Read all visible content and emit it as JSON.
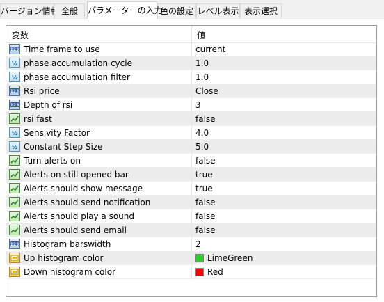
{
  "tabs": [
    {
      "label": "バージョン情報"
    },
    {
      "label": "全般"
    },
    {
      "label": "パラメーターの入力"
    },
    {
      "label": "色の設定"
    },
    {
      "label": "レベル表示"
    },
    {
      "label": "表示選択"
    }
  ],
  "active_tab": "パラメーターの入力",
  "grid": {
    "header": {
      "variable": "変数",
      "value": "値"
    },
    "rows": [
      {
        "name": "Time frame to use",
        "value": "current",
        "type": "int-icon"
      },
      {
        "name": "phase accumulation cycle",
        "value": "1.0",
        "type": "double-icon"
      },
      {
        "name": "phase accumulation filter",
        "value": "1.0",
        "type": "double-icon"
      },
      {
        "name": "Rsi price",
        "value": "Close",
        "type": "int-icon"
      },
      {
        "name": "Depth of rsi",
        "value": "3",
        "type": "int-icon"
      },
      {
        "name": "rsi fast",
        "value": "false",
        "type": "bool-icon"
      },
      {
        "name": "Sensivity Factor",
        "value": "4.0",
        "type": "double-icon"
      },
      {
        "name": "Constant Step Size",
        "value": "5.0",
        "type": "double-icon"
      },
      {
        "name": "Turn alerts on",
        "value": "false",
        "type": "bool-icon"
      },
      {
        "name": "Alerts on still opened bar",
        "value": "true",
        "type": "bool-icon"
      },
      {
        "name": "Alerts should show message",
        "value": "true",
        "type": "bool-icon"
      },
      {
        "name": "Alerts should send notification",
        "value": "false",
        "type": "bool-icon"
      },
      {
        "name": "Alerts should play a sound",
        "value": "false",
        "type": "bool-icon"
      },
      {
        "name": "Alerts should send email",
        "value": "false",
        "type": "bool-icon"
      },
      {
        "name": "Histogram barswidth",
        "value": "2",
        "type": "int-icon"
      },
      {
        "name": "Up histogram color",
        "value": "LimeGreen",
        "type": "color-icon",
        "swatch": "#32cd32"
      },
      {
        "name": "Down histogram color",
        "value": "Red",
        "type": "color-icon",
        "swatch": "#ff0000"
      }
    ]
  }
}
